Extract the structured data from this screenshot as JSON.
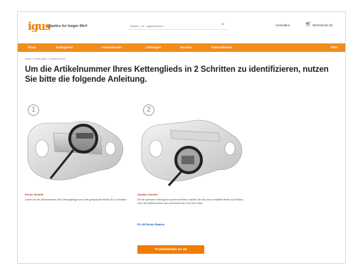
{
  "header": {
    "logo": "igus",
    "slogan": "plastics for longer life®",
    "search_placeholder": "Artikel z. B. Lagerbuchsen",
    "login_label": "Anmelden",
    "cart_label": "Warenkorb (0)"
  },
  "nav": {
    "items": [
      "Shop",
      "Kategorien",
      "Innovationen",
      "Lösungen",
      "Service",
      "Unternehmen"
    ],
    "right_label": "DEU"
  },
  "breadcrumb": "Home > Kettenglied > Artikelnummer",
  "title": "Um die Artikelnummer Ihres Kettenglieds in 2 Schritten zu identifizieren, nutzen Sie bitte die folgende Anleitung.",
  "steps": [
    {
      "number": "1",
      "title": "Erster Schritt:",
      "text": "Lesen Sie die Artikelnummer des Öffnungsbügel an et die gewünschte Breite (B) zu erhalten"
    },
    {
      "number": "2",
      "title": "Zweiter Schritt:",
      "text": "Mit der genauen Kettenglied suchen/ermitteln, wählen Sie die zuvor ermittelte Breite und Radius oder die Artikelnummer aus und bestell den Link zum Shop.",
      "link": "E2.1B Breite Radius"
    }
  ],
  "cta_label": "Produktdetails E2.1B"
}
